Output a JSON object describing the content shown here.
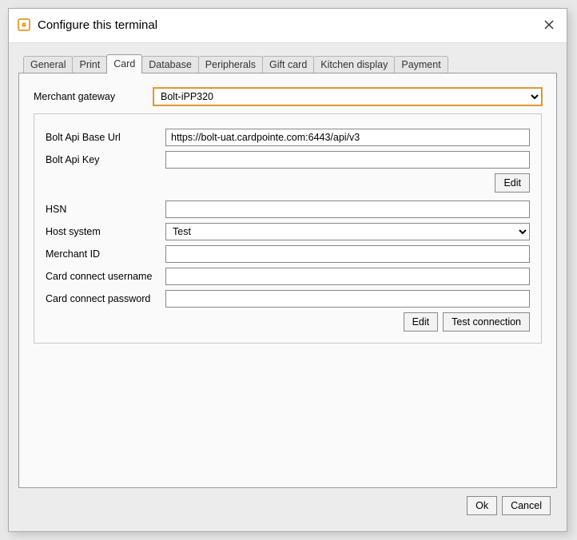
{
  "window": {
    "title": "Configure this terminal"
  },
  "tabs": {
    "items": [
      {
        "label": "General"
      },
      {
        "label": "Print"
      },
      {
        "label": "Card"
      },
      {
        "label": "Database"
      },
      {
        "label": "Peripherals"
      },
      {
        "label": "Gift card"
      },
      {
        "label": "Kitchen display"
      },
      {
        "label": "Payment"
      }
    ],
    "activeIndex": 2
  },
  "gateway": {
    "label": "Merchant gateway",
    "value": "Bolt-iPP320"
  },
  "fields": {
    "bolt_api_base_url": {
      "label": "Bolt Api Base Url",
      "value": "https://bolt-uat.cardpointe.com:6443/api/v3"
    },
    "bolt_api_key": {
      "label": "Bolt Api Key",
      "value": ""
    },
    "hsn": {
      "label": "HSN",
      "value": ""
    },
    "host_system": {
      "label": "Host system",
      "value": "Test"
    },
    "merchant_id": {
      "label": "Merchant ID",
      "value": ""
    },
    "cc_username": {
      "label": "Card connect username",
      "value": ""
    },
    "cc_password": {
      "label": "Card connect password",
      "value": ""
    }
  },
  "buttons": {
    "edit_top": "Edit",
    "edit_bottom": "Edit",
    "test_connection": "Test connection",
    "ok": "Ok",
    "cancel": "Cancel"
  }
}
